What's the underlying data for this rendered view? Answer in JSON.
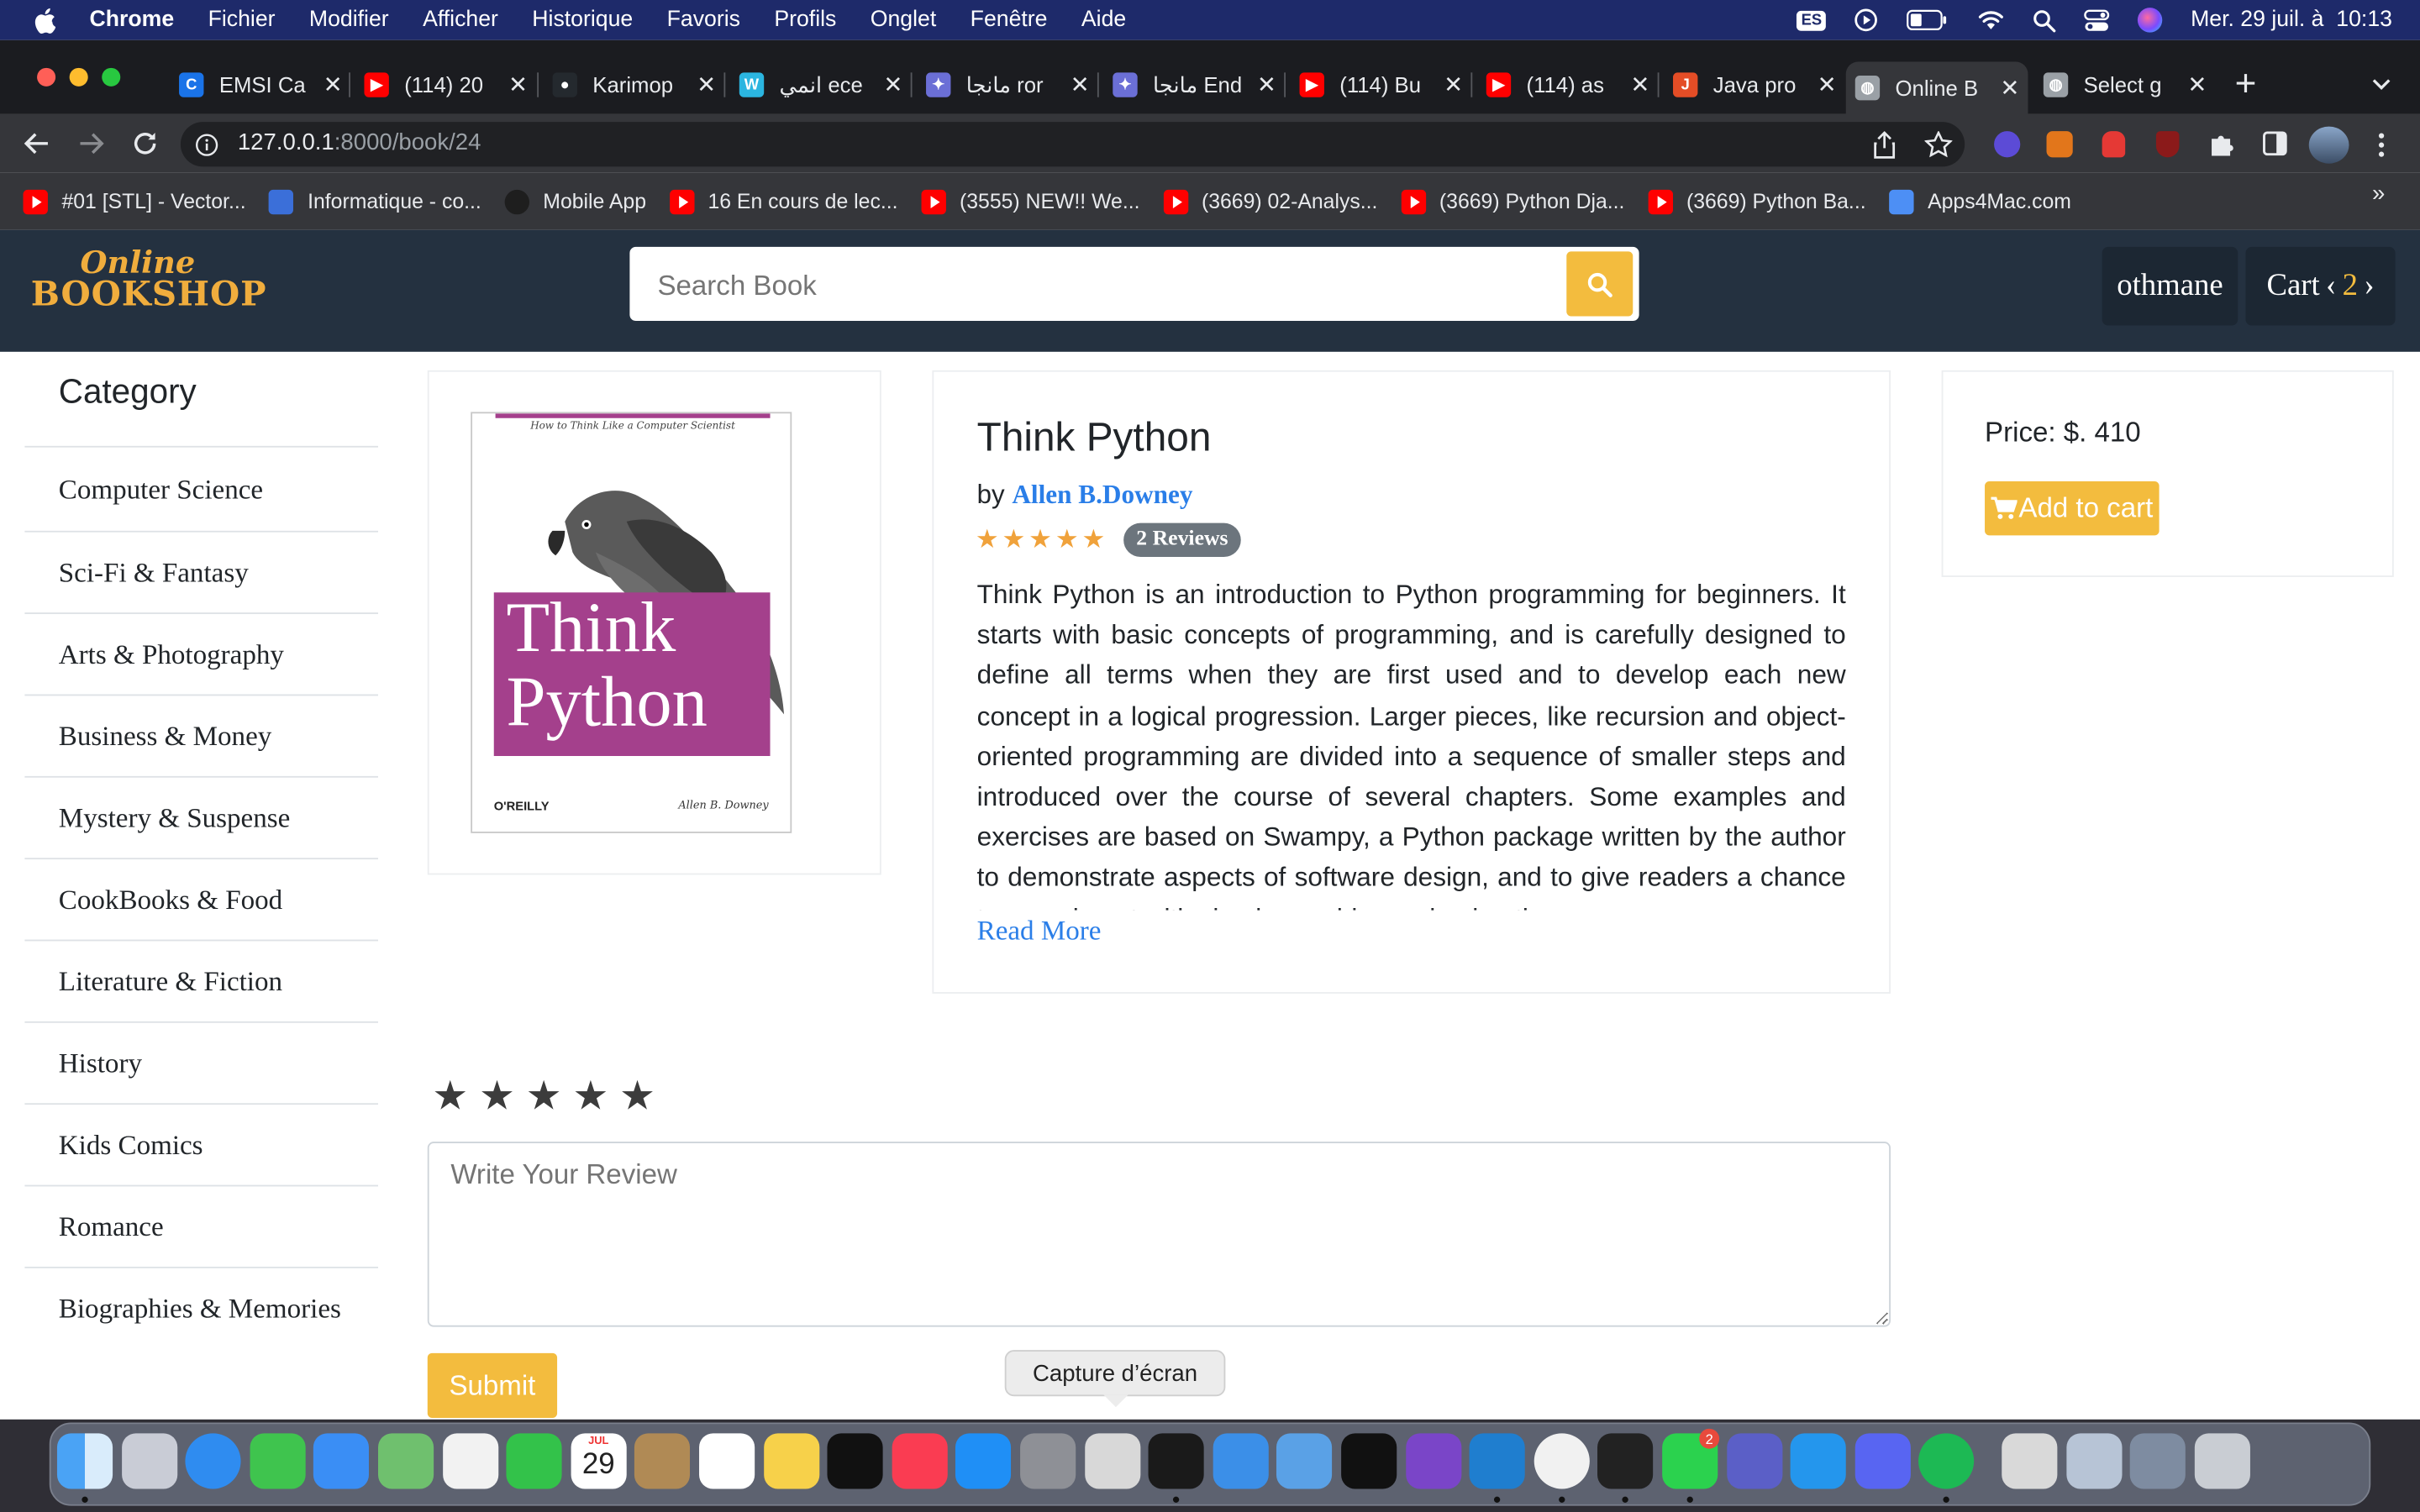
{
  "menubar": {
    "app": "Chrome",
    "items": [
      "Fichier",
      "Modifier",
      "Afficher",
      "Historique",
      "Favoris",
      "Profils",
      "Onglet",
      "Fenêtre",
      "Aide"
    ],
    "keyboard": "ES",
    "datetime": "Mer. 29 juil. à  10:13"
  },
  "tabs": [
    {
      "title": "EMSI Ca",
      "color": "#1a73e8",
      "glyph": "C"
    },
    {
      "title": "(114) 20",
      "color": "#ff0000",
      "glyph": "▶"
    },
    {
      "title": "Karimop",
      "color": "#24292e",
      "glyph": "●"
    },
    {
      "title": "انمي ece",
      "color": "#2bb5e0",
      "glyph": "W"
    },
    {
      "title": "مانجا ror",
      "color": "#6b6fd6",
      "glyph": "✦"
    },
    {
      "title": "مانجا End",
      "color": "#6b6fd6",
      "glyph": "✦"
    },
    {
      "title": "(114) Bu",
      "color": "#ff0000",
      "glyph": "▶"
    },
    {
      "title": "(114) as",
      "color": "#ff0000",
      "glyph": "▶"
    },
    {
      "title": "Java pro",
      "color": "#e44d26",
      "glyph": "J"
    },
    {
      "title": "Online B",
      "color": "#9aa0a6",
      "glyph": "◍",
      "active": true
    },
    {
      "title": "Select g",
      "color": "#9aa0a6",
      "glyph": "◍"
    }
  ],
  "address": {
    "host": "127.0.0.1",
    "path": ":8000/book/24"
  },
  "bookmarks": [
    {
      "label": "#01 [STL] - Vector...",
      "type": "yt"
    },
    {
      "label": "Informatique - co...",
      "type": "blue"
    },
    {
      "label": "Mobile App",
      "type": "gh"
    },
    {
      "label": "16 En cours de lec...",
      "type": "yt"
    },
    {
      "label": "(3555) NEW!! We...",
      "type": "yt"
    },
    {
      "label": "(3669) 02-Analys...",
      "type": "yt"
    },
    {
      "label": "(3669) Python Dja...",
      "type": "yt"
    },
    {
      "label": "(3669) Python Ba...",
      "type": "yt"
    },
    {
      "label": "Apps4Mac.com",
      "type": "app"
    }
  ],
  "site": {
    "logo_top": "Online",
    "logo_bottom": "BOOKSHOP",
    "search_placeholder": "Search Book",
    "username": "othmane",
    "cart_label": "Cart",
    "cart_count": "2"
  },
  "sidebar": {
    "title": "Category",
    "categories": [
      "Computer Science",
      "Sci-Fi & Fantasy",
      "Arts & Photography",
      "Business & Money",
      "Mystery & Suspense",
      "CookBooks & Food",
      "Literature & Fiction",
      "History",
      "Kids Comics",
      "Romance",
      "Biographies & Memories"
    ]
  },
  "book": {
    "cover": {
      "subtitle": "How to Think Like a Computer Scientist",
      "title_line1": "Think",
      "title_line2": "Python",
      "publisher": "O'REILLY",
      "author": "Allen B. Downey"
    },
    "title": "Think Python",
    "by": "by",
    "author": "Allen B.Downey",
    "stars": 5,
    "reviews": "2 Reviews",
    "description": "Think Python is an introduction to Python programming for beginners. It starts with basic concepts of programming, and is carefully designed to define all terms when they are first used and to develop each new concept in a logical progression. Larger pieces, like recursion and object-oriented programming are divided into a sequence of smaller steps and introduced over the course of several chapters. Some examples and exercises are based on Swampy, a Python package written by the author to demonstrate aspects of software design, and to give readers a chance to experiment with simple graphics and animation.",
    "read_more": "Read More",
    "price": "Price: $. 410",
    "add_to_cart": "Add to cart"
  },
  "review": {
    "placeholder": "Write Your Review",
    "submit": "Submit",
    "rating_stars": 5
  },
  "tooltip": "Capture d’écran",
  "dock": {
    "calendar_month": "JUL",
    "calendar_day": "29",
    "whatsapp_badge": "2",
    "apps": [
      "finder",
      "launchpad",
      "safari",
      "messages",
      "mail",
      "maps",
      "photos",
      "facetime",
      "calendar",
      "contacts",
      "reminders",
      "notes",
      "tv",
      "music",
      "appstore",
      "settings",
      "screenshot",
      "activity",
      "xcode",
      "simulator",
      "pycharm",
      "visualstudio",
      "vscode",
      "chrome",
      "terminal",
      "whatsapp",
      "teams",
      "docker",
      "discord",
      "spotify",
      "preview",
      "downloads",
      "windows",
      "trash"
    ]
  }
}
